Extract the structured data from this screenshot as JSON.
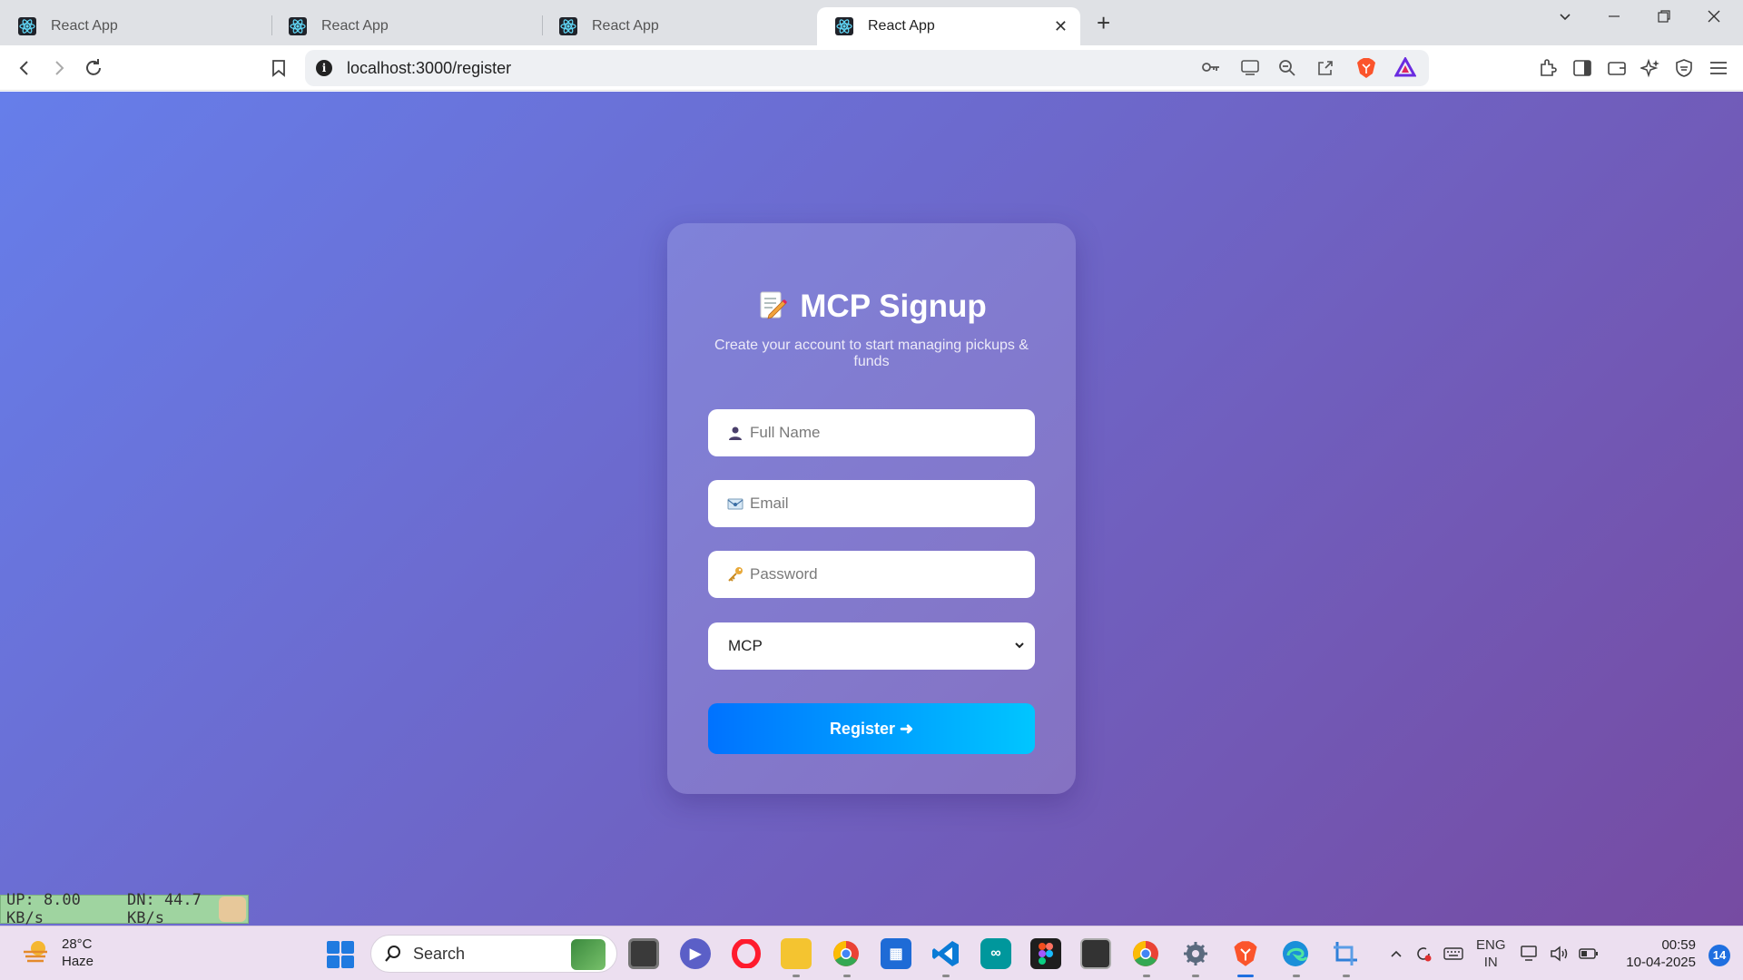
{
  "browser": {
    "tabs": [
      {
        "title": "React App",
        "active": false
      },
      {
        "title": "React App",
        "active": false
      },
      {
        "title": "React App",
        "active": false
      },
      {
        "title": "React App",
        "active": true
      }
    ],
    "url": "localhost:3000/register"
  },
  "signup": {
    "title": "MCP Signup",
    "subtitle": "Create your account to start managing pickups & funds",
    "full_name_placeholder": "Full Name",
    "email_placeholder": "Email",
    "password_placeholder": "Password",
    "role_selected": "MCP",
    "register_label": "Register ➜"
  },
  "netmon": {
    "up": "UP: 8.00 KB/s",
    "down": "DN: 44.7 KB/s"
  },
  "taskbar": {
    "weather_temp": "28°C",
    "weather_desc": "Haze",
    "search_label": "Search",
    "lang_top": "ENG",
    "lang_bottom": "IN",
    "time": "00:59",
    "date": "10-04-2025",
    "notification_count": "14"
  },
  "colors": {
    "bg_start": "#667eea",
    "bg_end": "#764ba2",
    "button_start": "#0072ff",
    "button_end": "#00c6ff"
  }
}
